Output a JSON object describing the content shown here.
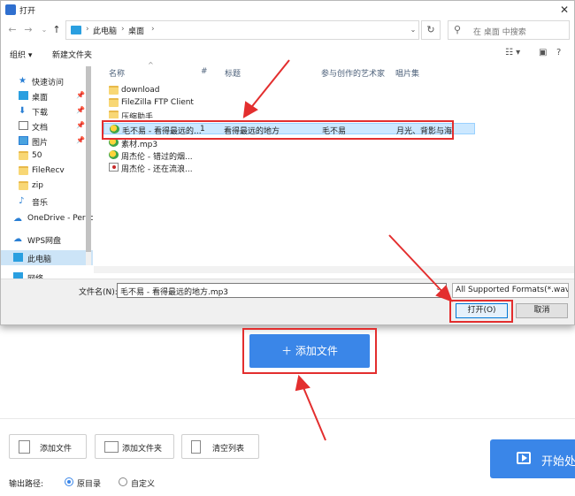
{
  "dialog": {
    "title": "打开",
    "address": {
      "crumbs": [
        "此电脑",
        "桌面"
      ],
      "sep": "›"
    },
    "search_placeholder": "在 桌面 中搜索",
    "toolbar": {
      "organize": "组织 ▾",
      "new_folder": "新建文件夹"
    },
    "sidebar": [
      {
        "label": "快速访问",
        "icon": "star-icon"
      },
      {
        "label": "桌面",
        "icon": "desktop-icon",
        "pinned": true
      },
      {
        "label": "下载",
        "icon": "download-icon",
        "pinned": true
      },
      {
        "label": "文档",
        "icon": "document-icon",
        "pinned": true
      },
      {
        "label": "图片",
        "icon": "picture-icon",
        "pinned": true
      },
      {
        "label": "50",
        "icon": "folder-icon"
      },
      {
        "label": "FileRecv",
        "icon": "folder-icon"
      },
      {
        "label": "zip",
        "icon": "folder-icon"
      },
      {
        "label": "音乐",
        "icon": "music-icon"
      },
      {
        "label": "OneDrive - Perso",
        "icon": "cloud-icon"
      },
      {
        "label": "WPS网盘",
        "icon": "cloud-icon"
      },
      {
        "label": "此电脑",
        "icon": "computer-icon",
        "selected": true
      },
      {
        "label": "网络",
        "icon": "network-icon"
      }
    ],
    "columns": [
      "名称",
      "#",
      "标题",
      "参与创作的艺术家",
      "唱片集"
    ],
    "files": [
      {
        "name": "download",
        "type": "folder"
      },
      {
        "name": "FileZilla FTP Client",
        "type": "folder"
      },
      {
        "name": "压缩助手",
        "type": "folder"
      },
      {
        "name": "毛不易 - 看得最远的...",
        "type": "mp3",
        "num": "1",
        "title": "看得最远的地方",
        "artist": "毛不易",
        "album": "月光、背影与海",
        "selected": true
      },
      {
        "name": "素材.mp3",
        "type": "mp3"
      },
      {
        "name": "周杰伦 - 错过的烟...",
        "type": "mp3"
      },
      {
        "name": "周杰伦 - 还在流浪...",
        "type": "wav"
      }
    ],
    "filename_label": "文件名(N):",
    "filename_value": "毛不易 - 看得最远的地方.mp3",
    "filetype_value": "All Supported Formats(*.wav",
    "open_button": "打开(O)",
    "cancel_button": "取消"
  },
  "app": {
    "add_file_big": "添加文件",
    "add_file": "添加文件",
    "add_folder": "添加文件夹",
    "clear_list": "清空列表",
    "start": "开始处",
    "output_label": "输出路径:",
    "radio_original": "原目录",
    "radio_custom": "自定义"
  },
  "colors": {
    "accent": "#3a86e8",
    "annotation": "#e32e2e",
    "selection": "#cce8ff"
  }
}
